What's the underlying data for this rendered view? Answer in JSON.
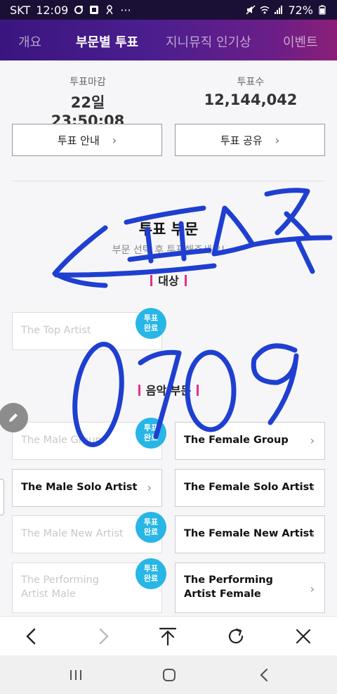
{
  "status": {
    "carrier": "SKT",
    "time": "12:09",
    "dots": "···",
    "battery": "72%"
  },
  "tabs": [
    {
      "label": "개요",
      "active": false
    },
    {
      "label": "부문별 투표",
      "active": true
    },
    {
      "label": "지니뮤직 인기상",
      "active": false
    },
    {
      "label": "이벤트",
      "active": false
    }
  ],
  "vote_info": {
    "deadline_label": "투표마감",
    "deadline_value": "22일 23:50:08",
    "count_label": "투표수",
    "count_value": "12,144,042"
  },
  "buttons": {
    "guide": "투표 안내",
    "share": "투표 공유",
    "chevron": "›"
  },
  "section": {
    "title": "투표 부문",
    "subtitle": "부문 선택 후 투표해주세요!"
  },
  "categories": {
    "grand": "대상",
    "music": "음악 부문"
  },
  "badge_label": "투표\n완료",
  "cards": {
    "top_artist": {
      "label": "The Top Artist",
      "done": true
    },
    "male_group": {
      "label": "The Male Group",
      "done": true
    },
    "female_group": {
      "label": "The Female Group",
      "done": false
    },
    "male_solo": {
      "label": "The Male Solo Artist",
      "done": false
    },
    "female_solo": {
      "label": "The Female Solo Artist",
      "done": false
    },
    "male_new": {
      "label": "The Male New Artist",
      "done": true
    },
    "female_new": {
      "label": "The Female New Artist",
      "done": false
    },
    "perf_male_l1": {
      "label": "The Performing"
    },
    "perf_male_l2": {
      "label": "Artist Male",
      "done": true
    },
    "perf_female_l1": {
      "label": "The Performing"
    },
    "perf_female_l2": {
      "label": "Artist Female",
      "done": false
    }
  },
  "colors": {
    "accent_badge": "#27b6e6",
    "category_bar": "#e0318d",
    "scribble": "#1f3fd1",
    "tabbar_start": "#3a1580",
    "tabbar_end": "#8b1f78"
  },
  "icons": {
    "back": "chevron-left-icon",
    "forward": "chevron-right-icon",
    "top": "arrow-up-icon",
    "reload": "reload-icon",
    "close": "close-icon",
    "edit": "pencil-icon",
    "recents": "recent-apps-icon",
    "home": "home-icon",
    "nav_back": "nav-back-icon"
  }
}
